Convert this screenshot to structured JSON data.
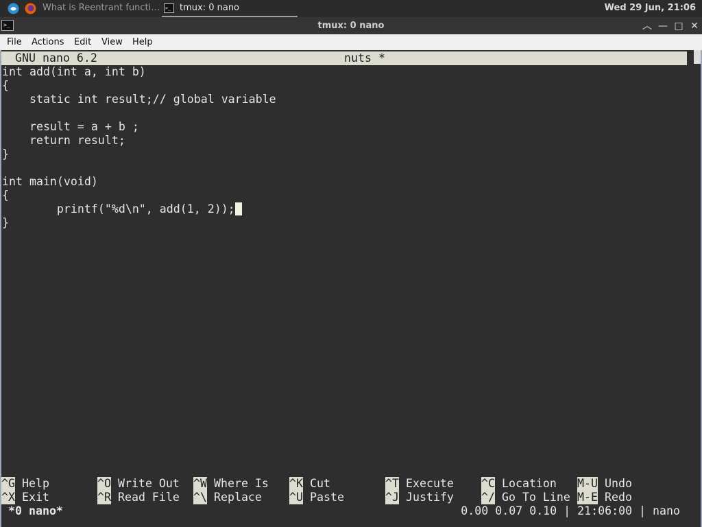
{
  "taskbar": {
    "browser_task": "What is Reentrant functi…",
    "terminal_task": "tmux: 0 nano",
    "clock": "Wed 29 Jun, 21:06"
  },
  "window": {
    "title": "tmux: 0 nano",
    "icons": [
      "terminal-icon",
      "minimize-up-icon",
      "minimize-icon",
      "maximize-icon",
      "close-icon"
    ]
  },
  "menu": {
    "items": [
      "File",
      "Actions",
      "Edit",
      "View",
      "Help"
    ]
  },
  "nano": {
    "version": "GNU nano 6.2",
    "filename": "nuts *",
    "lines": [
      "int add(int a, int b)",
      "{",
      "    static int result;// global variable",
      "",
      "    result = a + b ;",
      "    return result;",
      "}",
      "",
      "int main(void)",
      "{",
      "        printf(\"%d\\n\", add(1, 2));",
      "}"
    ],
    "shortcuts_row1": [
      {
        "key": "^G",
        "label": "Help"
      },
      {
        "key": "^O",
        "label": "Write Out"
      },
      {
        "key": "^W",
        "label": "Where Is"
      },
      {
        "key": "^K",
        "label": "Cut"
      },
      {
        "key": "^T",
        "label": "Execute"
      },
      {
        "key": "^C",
        "label": "Location"
      },
      {
        "key": "M-U",
        "label": "Undo"
      }
    ],
    "shortcuts_row2": [
      {
        "key": "^X",
        "label": "Exit"
      },
      {
        "key": "^R",
        "label": "Read File"
      },
      {
        "key": "^\\",
        "label": "Replace"
      },
      {
        "key": "^U",
        "label": "Paste"
      },
      {
        "key": "^J",
        "label": "Justify"
      },
      {
        "key": "^/",
        "label": "Go To Line"
      },
      {
        "key": "M-E",
        "label": "Redo"
      }
    ]
  },
  "tmux": {
    "window": "*0 nano*",
    "status_right": "0.00 0.07 0.10 | 21:06:00 | nano"
  },
  "colors": {
    "terminal_bg": "#2e2e2e",
    "terminal_fg": "#e6e6e6",
    "header_bg": "#dcdcd0",
    "menubar_bg": "#f0f0f0"
  }
}
